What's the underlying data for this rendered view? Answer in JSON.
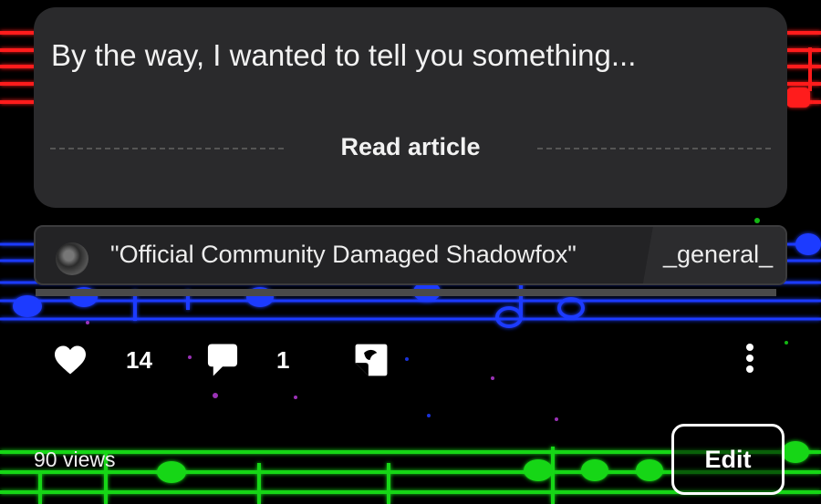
{
  "article": {
    "preview_text": "By the way, I wanted to tell you something...",
    "read_label": "Read article"
  },
  "community": {
    "name": "\"Official Community Damaged Shadowfox\"",
    "tag": "_general_"
  },
  "actions": {
    "likes": "14",
    "comments": "1"
  },
  "footer": {
    "views": "90 views",
    "edit_label": "Edit"
  },
  "colors": {
    "card_bg": "#2a2a2c",
    "staff_red": "#ff1a1a",
    "staff_blue": "#1f3bff",
    "staff_green": "#16d616"
  },
  "icons": [
    "heart-icon",
    "comment-icon",
    "share-icon",
    "more-icon"
  ]
}
